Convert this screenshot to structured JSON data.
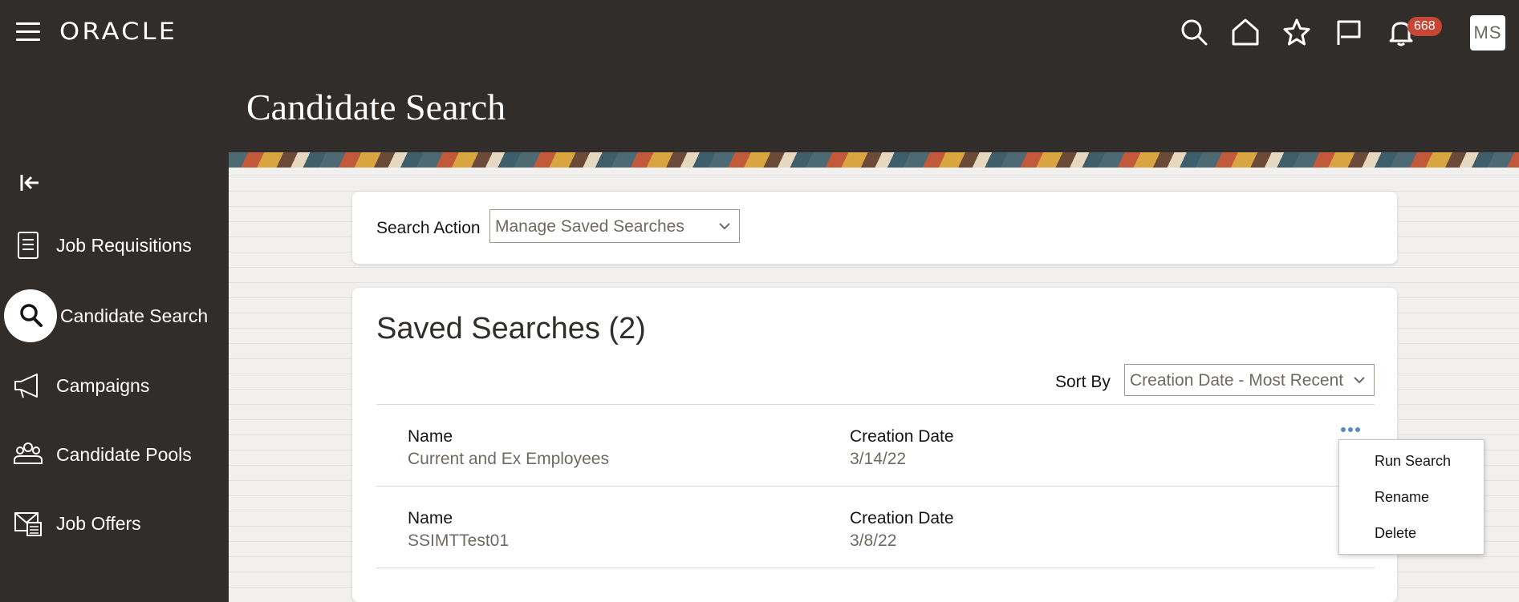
{
  "header": {
    "logo": "ORACLE",
    "notification_count": "668",
    "user_initials": "MS",
    "icons": [
      "menu-icon",
      "search-icon",
      "home-icon",
      "star-icon",
      "flag-icon",
      "bell-icon"
    ]
  },
  "page": {
    "title": "Candidate Search"
  },
  "sidebar": {
    "items": [
      {
        "label": "Job Requisitions",
        "icon": "document-icon"
      },
      {
        "label": "Candidate Search",
        "icon": "search-icon",
        "active": true
      },
      {
        "label": "Campaigns",
        "icon": "megaphone-icon"
      },
      {
        "label": "Candidate Pools",
        "icon": "people-icon"
      },
      {
        "label": "Job Offers",
        "icon": "offer-letter-icon"
      }
    ]
  },
  "search_action": {
    "label": "Search Action",
    "selected": "Manage Saved Searches"
  },
  "saved_searches": {
    "title": "Saved Searches (2)",
    "sort_by_label": "Sort By",
    "sort_by_selected": "Creation Date - Most Recent",
    "rows": [
      {
        "name_label": "Name",
        "name": "Current and Ex Employees",
        "date_label": "Creation Date",
        "date": "3/14/22"
      },
      {
        "name_label": "Name",
        "name": "SSIMTTest01",
        "date_label": "Creation Date",
        "date": "3/8/22"
      }
    ]
  },
  "context_menu": {
    "items": [
      "Run Search",
      "Rename",
      "Delete"
    ]
  },
  "colors": {
    "header_bg": "#312d2a",
    "badge": "#c74634",
    "more_dots": "#5b8ac0"
  }
}
